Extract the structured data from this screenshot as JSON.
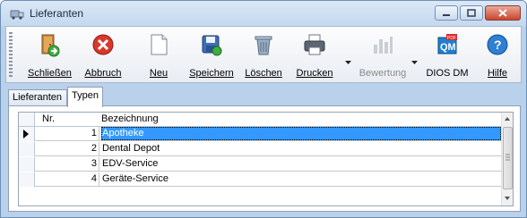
{
  "window": {
    "title": "Lieferanten"
  },
  "toolbar": {
    "buttons": [
      {
        "label": "Schließen",
        "icon": "exit-door-icon"
      },
      {
        "label": "Abbruch",
        "icon": "cancel-icon"
      },
      {
        "label": "Neu",
        "icon": "new-document-icon"
      },
      {
        "label": "Speichern",
        "icon": "save-icon"
      },
      {
        "label": "Löschen",
        "icon": "trash-icon"
      },
      {
        "label": "Drucken",
        "icon": "printer-icon"
      },
      {
        "label": "Bewertung",
        "icon": "rating-icon"
      },
      {
        "label": "DIOS DM",
        "icon": "qm-pdf-icon"
      },
      {
        "label": "Hilfe",
        "icon": "help-icon"
      }
    ]
  },
  "tabs": [
    {
      "label": "Lieferanten"
    },
    {
      "label": "Typen"
    }
  ],
  "grid": {
    "columns": [
      "Nr.",
      "Bezeichnung"
    ],
    "rows": [
      {
        "nr": "1",
        "bezeichnung": "Apotheke"
      },
      {
        "nr": "2",
        "bezeichnung": "Dental Depot"
      },
      {
        "nr": "3",
        "bezeichnung": "EDV-Service"
      },
      {
        "nr": "4",
        "bezeichnung": "Geräte-Service"
      }
    ]
  },
  "colors": {
    "selection": "#3399ff",
    "window_frame": "#b9d1ea",
    "close_button": "#c9462c"
  }
}
